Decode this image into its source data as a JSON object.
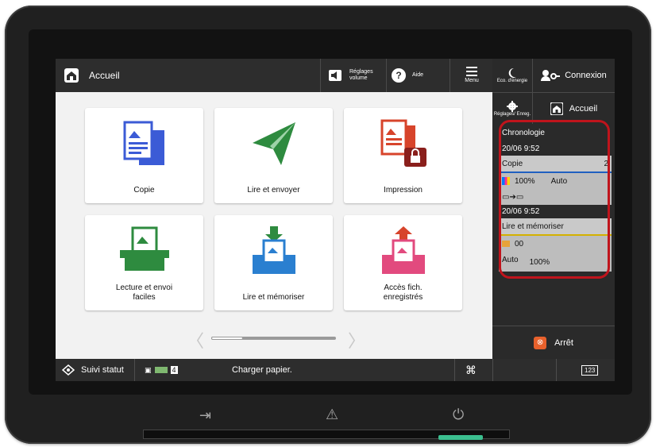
{
  "topbar": {
    "home_label": "Accueil",
    "volume_label": "Réglages volume",
    "help_label": "Aide",
    "menu_label": "Menu"
  },
  "right_panel": {
    "eco_label": "Eco. d'énergie",
    "login_label": "Connexion",
    "settings_label": "Réglages/ Enreg.",
    "home_label": "Accueil",
    "stop_label": "Arrêt",
    "history": {
      "title": "Chronologie",
      "entries": [
        {
          "time": "20/06 9:52",
          "job": "Copie",
          "count": "2",
          "zoom": "100%",
          "mode": "Auto"
        },
        {
          "time": "20/06 9:52",
          "job": "Lire et mémoriser",
          "code": "00",
          "mode": "Auto",
          "zoom": "100%"
        }
      ]
    }
  },
  "apps": [
    {
      "label": "Copie"
    },
    {
      "label": "Lire et envoyer"
    },
    {
      "label": "Impression"
    },
    {
      "label": "Lecture et envoi faciles"
    },
    {
      "label": "Lire et mémoriser"
    },
    {
      "label": "Accès fich. enregistrés"
    }
  ],
  "statusbar": {
    "status_label": "Suivi statut",
    "counter": "4",
    "message": "Charger papier.",
    "keypad_label": "123"
  },
  "colors": {
    "bar_bg": "#2d2d2d",
    "highlight_ring": "#c0141c",
    "copy_blue": "#3b5bd6",
    "send_green": "#2e8b3f",
    "print_red": "#d7442b",
    "store_blue": "#2a7fd0",
    "access_pink": "#e24a7e",
    "led_green": "#3bbf8f"
  }
}
